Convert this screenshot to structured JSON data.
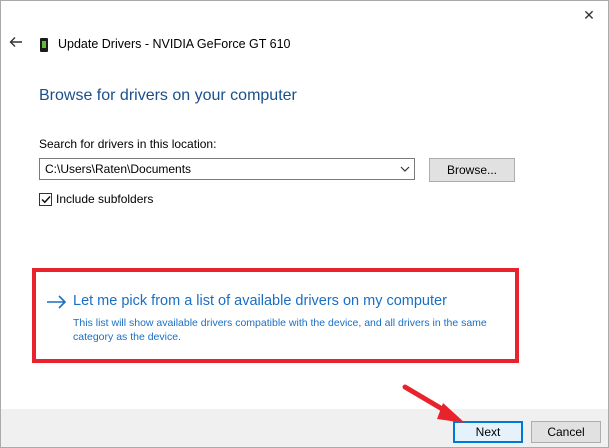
{
  "window": {
    "close_glyph": "✕",
    "title": "Update Drivers - NVIDIA GeForce GT 610"
  },
  "main": {
    "heading": "Browse for drivers on your computer",
    "search_label": "Search for drivers in this location:",
    "path_value": "C:\\Users\\Raten\\Documents",
    "browse_label": "Browse...",
    "include_subfolders_label": "Include subfolders",
    "include_subfolders_checked": true
  },
  "option": {
    "title": "Let me pick from a list of available drivers on my computer",
    "description": "This list will show available drivers compatible with the device, and all drivers in the same category as the device."
  },
  "footer": {
    "next_label": "Next",
    "cancel_label": "Cancel"
  },
  "colors": {
    "heading": "#1a4f8c",
    "link": "#1a6fc4",
    "highlight": "#e8232b",
    "primary_button_border": "#0078d7"
  },
  "icons": {
    "back": "back-arrow-icon",
    "device": "graphics-card-icon",
    "dropdown": "chevron-down-icon",
    "option": "arrow-right-icon",
    "check": "checkmark-icon"
  }
}
